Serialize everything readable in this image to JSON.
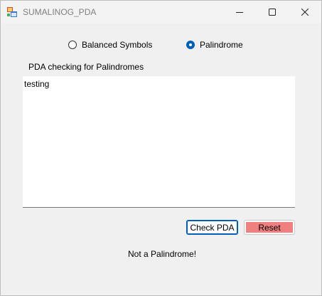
{
  "window": {
    "title": "SUMALINOG_PDA",
    "icon": "winforms-app-icon"
  },
  "modes": {
    "balanced_label": "Balanced Symbols",
    "palindrome_label": "Palindrome",
    "selected": "Palindrome"
  },
  "section_label": "PDA checking for Palindromes",
  "input": {
    "value": "testing"
  },
  "buttons": {
    "check_label": "Check PDA",
    "reset_label": "Reset"
  },
  "result_text": "Not a Palindrome!",
  "colors": {
    "accent": "#005fb8",
    "reset_fill": "#f08080"
  }
}
